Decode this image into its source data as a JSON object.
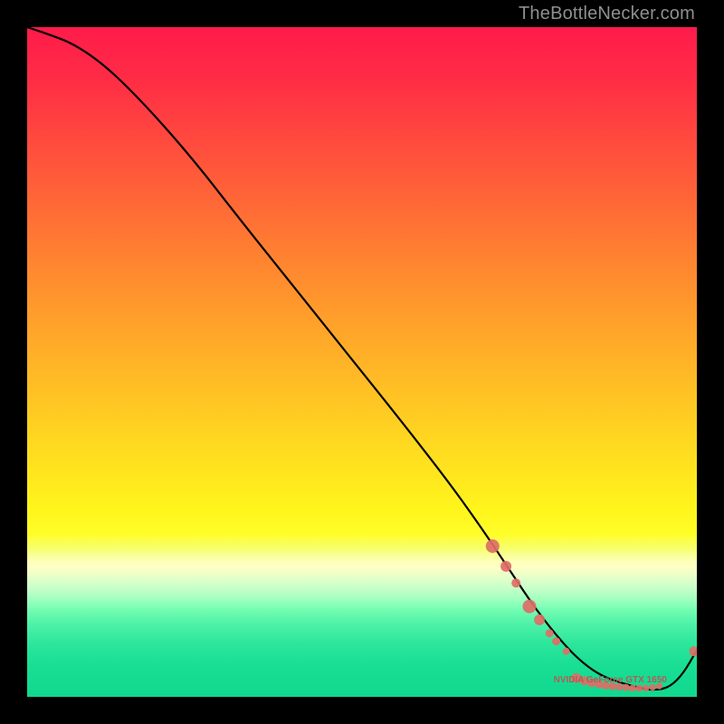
{
  "watermark": "TheBottleNecker.com",
  "chart_data": {
    "type": "line",
    "title": "",
    "xlabel": "",
    "ylabel": "",
    "xlim": [
      0,
      100
    ],
    "ylim": [
      0,
      100
    ],
    "grid": false,
    "series": [
      {
        "name": "bottleneck-curve",
        "x": [
          0,
          3,
          7,
          12,
          18,
          25,
          32,
          40,
          48,
          56,
          63,
          68,
          72,
          76,
          80,
          83,
          86,
          89,
          92,
          94,
          96,
          98,
          100
        ],
        "y": [
          100,
          99,
          97.5,
          94,
          88,
          80,
          71,
          61,
          51,
          41,
          32,
          25,
          19,
          13,
          8,
          5,
          3,
          2,
          1.2,
          1.0,
          1.5,
          3.5,
          7
        ],
        "color": "#000000"
      }
    ],
    "markers": {
      "color": "#de6e66",
      "radius_scale": 1.0,
      "points": [
        {
          "x": 69.5,
          "y": 22.5,
          "r": 7.5
        },
        {
          "x": 71.5,
          "y": 19.5,
          "r": 6.0
        },
        {
          "x": 73.0,
          "y": 17.0,
          "r": 5.0
        },
        {
          "x": 75.0,
          "y": 13.5,
          "r": 7.5
        },
        {
          "x": 76.5,
          "y": 11.5,
          "r": 6.0
        },
        {
          "x": 78.0,
          "y": 9.5,
          "r": 4.5
        },
        {
          "x": 79.0,
          "y": 8.3,
          "r": 4.5
        },
        {
          "x": 80.5,
          "y": 6.8,
          "r": 4.0
        },
        {
          "x": 82.0,
          "y": 2.8,
          "r": 5.5
        },
        {
          "x": 83.2,
          "y": 2.4,
          "r": 5.0
        },
        {
          "x": 84.3,
          "y": 2.1,
          "r": 4.8
        },
        {
          "x": 85.4,
          "y": 1.9,
          "r": 4.6
        },
        {
          "x": 86.4,
          "y": 1.7,
          "r": 4.4
        },
        {
          "x": 87.4,
          "y": 1.6,
          "r": 4.3
        },
        {
          "x": 88.4,
          "y": 1.5,
          "r": 4.1
        },
        {
          "x": 89.4,
          "y": 1.4,
          "r": 4.0
        },
        {
          "x": 90.4,
          "y": 1.3,
          "r": 3.9
        },
        {
          "x": 91.4,
          "y": 1.3,
          "r": 3.8
        },
        {
          "x": 92.4,
          "y": 1.3,
          "r": 3.7
        },
        {
          "x": 93.4,
          "y": 1.4,
          "r": 3.6
        },
        {
          "x": 94.4,
          "y": 1.6,
          "r": 3.5
        },
        {
          "x": 99.6,
          "y": 6.8,
          "r": 5.5
        }
      ]
    },
    "annotations": [
      {
        "text": "NVIDIA GeForce GTX 1650",
        "x": 84,
        "y": 2.4
      }
    ]
  },
  "colors": {
    "marker": "#de6e66",
    "curve": "#000000",
    "watermark": "#8f8f8f"
  }
}
